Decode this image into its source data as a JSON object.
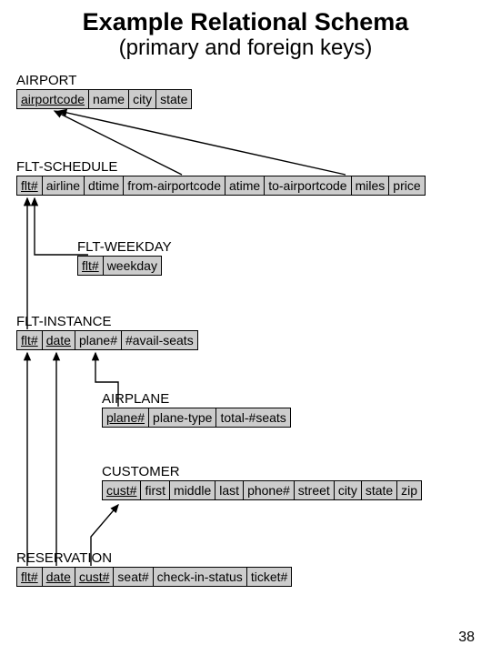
{
  "title": "Example Relational Schema",
  "subtitle": "(primary and foreign keys)",
  "pagenum": "38",
  "airport": {
    "label": "AIRPORT",
    "cols": {
      "airportcode": "airportcode",
      "name": "name",
      "city": "city",
      "state": "state"
    }
  },
  "fltschedule": {
    "label": "FLT-SCHEDULE",
    "cols": {
      "flt": "flt#",
      "airline": "airline",
      "dtime": "dtime",
      "from": "from-airportcode",
      "atime": "atime",
      "to": "to-airportcode",
      "miles": "miles",
      "price": "price"
    }
  },
  "fltweekday": {
    "label": "FLT-WEEKDAY",
    "cols": {
      "flt": "flt#",
      "weekday": "weekday"
    }
  },
  "fltinstance": {
    "label": "FLT-INSTANCE",
    "cols": {
      "flt": "flt#",
      "date": "date",
      "plane": "plane#",
      "avail": "#avail-seats"
    }
  },
  "airplane": {
    "label": "AIRPLANE",
    "cols": {
      "plane": "plane#",
      "type": "plane-type",
      "seats": "total-#seats"
    }
  },
  "customer": {
    "label": "CUSTOMER",
    "cols": {
      "cust": "cust#",
      "first": "first",
      "middle": "middle",
      "last": "last",
      "phone": "phone#",
      "street": "street",
      "city": "city",
      "state": "state",
      "zip": "zip"
    }
  },
  "reservation": {
    "label": "RESERVATION",
    "cols": {
      "flt": "flt#",
      "date": "date",
      "cust": "cust#",
      "seat": "seat#",
      "checkin": "check-in-status",
      "ticket": "ticket#"
    }
  }
}
